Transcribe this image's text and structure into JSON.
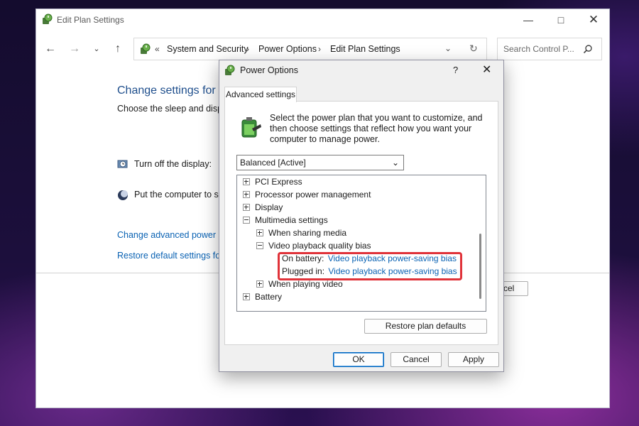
{
  "main_window": {
    "title": "Edit Plan Settings",
    "address": {
      "overflow": "«",
      "crumbs": [
        "System and Security",
        "Power Options",
        "Edit Plan Settings"
      ]
    },
    "search_placeholder": "Search Control P...",
    "heading": "Change settings for t",
    "subheading": "Choose the sleep and displa",
    "display_label": "Turn off the display:",
    "sleep_label": "Put the computer to sl",
    "advanced_link": "Change advanced power se",
    "restore_link": "Restore default settings for",
    "cancel_fragment": "cel"
  },
  "dialog": {
    "title": "Power Options",
    "help": "?",
    "tab_label": "Advanced settings",
    "description": "Select the power plan that you want to customize, and then choose settings that reflect how you want your computer to manage power.",
    "plan_selected": "Balanced [Active]",
    "tree": {
      "pci_express": "PCI Express",
      "processor": "Processor power management",
      "display": "Display",
      "multimedia": "Multimedia settings",
      "sharing_media": "When sharing media",
      "video_quality": "Video playback quality bias",
      "on_battery_label": "On battery:",
      "on_battery_value": "Video playback power-saving bias",
      "plugged_in_label": "Plugged in:",
      "plugged_in_value": "Video playback power-saving bias",
      "playing_video": "When playing video",
      "battery": "Battery"
    },
    "restore_defaults": "Restore plan defaults",
    "ok": "OK",
    "cancel": "Cancel",
    "apply": "Apply"
  },
  "colors": {
    "link": "#0a62b3",
    "highlight": "#e0333a",
    "primary_button": "#0067c0"
  },
  "icons": [
    "power-options-icon",
    "back-arrow-icon",
    "forward-arrow-icon",
    "chevron-down-icon",
    "up-arrow-icon",
    "refresh-icon",
    "search-icon",
    "minimize-icon",
    "maximize-icon",
    "close-icon",
    "display-clock-icon",
    "moon-icon",
    "battery-plug-icon"
  ]
}
